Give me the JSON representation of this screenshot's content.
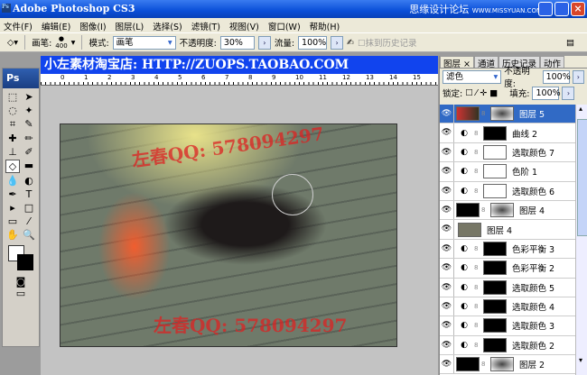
{
  "title": "Adobe Photoshop CS3",
  "brand": {
    "name": "思缘设计论坛",
    "url": "WWW.MISSYUAN.COM"
  },
  "menu": [
    "文件(F)",
    "编辑(E)",
    "图像(I)",
    "图层(L)",
    "选择(S)",
    "滤镜(T)",
    "视图(V)",
    "窗口(W)",
    "帮助(H)"
  ],
  "options": {
    "brush_label": "画笔:",
    "brush_size": "400",
    "mode_label": "模式:",
    "mode": "画笔",
    "opacity_label": "不透明度:",
    "opacity": "30%",
    "flow_label": "流量:",
    "flow": "100%",
    "history_label": "抹到历史记录"
  },
  "banner": "小左素材淘宝店: HTTP://ZUOPS.TAOBAO.COM",
  "ruler": [
    "0",
    "1",
    "2",
    "3",
    "4",
    "5",
    "6",
    "7",
    "8",
    "9",
    "10",
    "11",
    "12",
    "13",
    "14",
    "15"
  ],
  "watermark": "左春QQ: 578094297",
  "toolbox_title": "Ps",
  "panel": {
    "tabs": [
      "图层 ×",
      "通道",
      "历史记录",
      "动作"
    ],
    "blend": "滤色",
    "opacity_label": "不透明度:",
    "opacity": "100%",
    "lock_label": "锁定:",
    "fill_label": "填充:",
    "fill": "100%",
    "layers": [
      {
        "name": "图层 5",
        "type": "layer",
        "selected": true
      },
      {
        "name": "曲线 2",
        "type": "adj"
      },
      {
        "name": "选取颜色 7",
        "type": "adj"
      },
      {
        "name": "色阶 1",
        "type": "adj"
      },
      {
        "name": "选取颜色 6",
        "type": "adj"
      },
      {
        "name": "图层 4",
        "type": "layer"
      },
      {
        "name": "图层 4",
        "type": "photo"
      },
      {
        "name": "色彩平衡 3",
        "type": "adj"
      },
      {
        "name": "色彩平衡 2",
        "type": "adj"
      },
      {
        "name": "选取颜色 5",
        "type": "adj"
      },
      {
        "name": "选取颜色 4",
        "type": "adj"
      },
      {
        "name": "选取颜色 3",
        "type": "adj"
      },
      {
        "name": "选取颜色 2",
        "type": "adj"
      },
      {
        "name": "图层 2",
        "type": "layer"
      }
    ]
  }
}
